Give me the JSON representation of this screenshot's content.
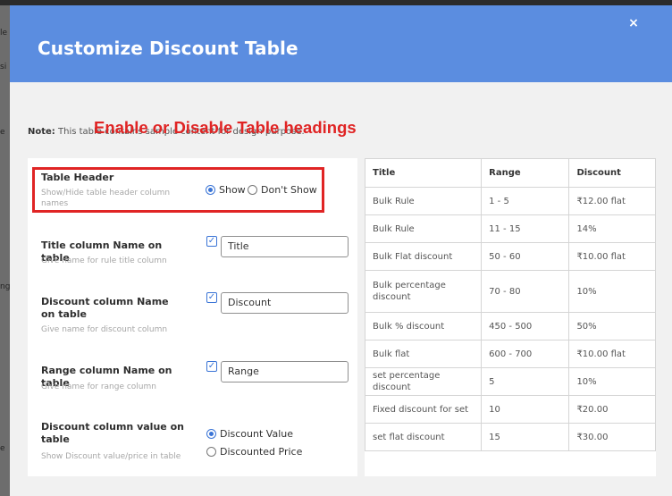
{
  "background": {
    "fragments": [
      "le",
      "si",
      "e",
      "ng",
      "e"
    ]
  },
  "modal": {
    "title": "Customize Discount Table",
    "close_label": "×"
  },
  "annotation": "Enable or Disable Table headings",
  "note": {
    "label": "Note:",
    "text": "This table contains sample content for design purpose."
  },
  "settings": {
    "table_header": {
      "title": "Table Header",
      "description": "Show/Hide table header column names",
      "options": [
        "Show",
        "Don't Show"
      ],
      "selected": "Show"
    },
    "title_column": {
      "title": "Title column Name on table",
      "description": "Give name for rule title column",
      "checked": true,
      "value": "Title"
    },
    "discount_column": {
      "title": "Discount column Name on table",
      "description": "Give name for discount column",
      "checked": true,
      "value": "Discount"
    },
    "range_column": {
      "title": "Range column Name on table",
      "description": "Give name for range column",
      "checked": true,
      "value": "Range"
    },
    "value_column": {
      "title": "Discount column value on table",
      "description": "Show Discount value/price in table",
      "options": [
        "Discount Value",
        "Discounted Price"
      ],
      "selected": "Discount Value"
    }
  },
  "preview_table": {
    "headers": [
      "Title",
      "Range",
      "Discount"
    ],
    "rows": [
      [
        "Bulk Rule",
        "1 - 5",
        "₹12.00 flat"
      ],
      [
        "Bulk Rule",
        "11 - 15",
        "14%"
      ],
      [
        "Bulk Flat discount",
        "50 - 60",
        "₹10.00 flat"
      ],
      [
        "Bulk percentage discount",
        "70 - 80",
        "10%"
      ],
      [
        "Bulk % discount",
        "450 - 500",
        "50%"
      ],
      [
        "Bulk flat",
        "600 - 700",
        "₹10.00 flat"
      ],
      [
        "set percentage discount",
        "5",
        "10%"
      ],
      [
        "Fixed discount for set",
        "10",
        "₹20.00"
      ],
      [
        "set flat discount",
        "15",
        "₹30.00"
      ]
    ]
  },
  "colors": {
    "header": "#5b8de0",
    "annotation": "#e02424",
    "accent": "#3a74d6"
  }
}
